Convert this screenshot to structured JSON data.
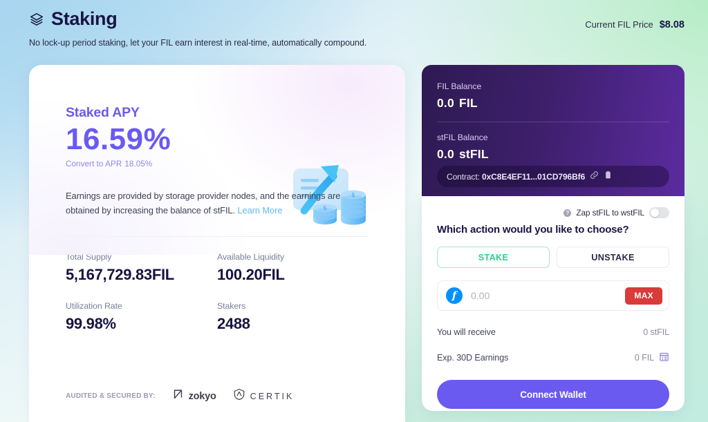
{
  "header": {
    "title": "Staking",
    "logo_icon": "layers-stack-icon",
    "subtitle": "No lock-up period staking, let your FIL earn interest in real-time, automatically compound.",
    "price_label": "Current FIL Price",
    "price_value": "$8.08"
  },
  "left_card": {
    "apy_label": "Staked APY",
    "apy_value": "16.59%",
    "convert_label": "Convert to APR",
    "convert_value": "18.05%",
    "description_text": "Earnings are provided by storage provider nodes, and the earnings are obtained by increasing the balance of stFIL.",
    "learn_more": "Learn More",
    "stats": [
      {
        "label": "Total Supply",
        "value": "5,167,729.83FIL"
      },
      {
        "label": "Available Liquidity",
        "value": "100.20FIL"
      },
      {
        "label": "Utilization Rate",
        "value": "99.98%"
      },
      {
        "label": "Stakers",
        "value": "2488"
      }
    ],
    "audit_label": "AUDITED & SECURED BY:",
    "auditors": [
      {
        "name": "zokyo",
        "icon": "zokyo-arrow-icon"
      },
      {
        "name": "CERTIK",
        "icon": "certik-shield-icon"
      }
    ]
  },
  "balance_card": {
    "fil_balance_label": "FIL Balance",
    "fil_balance_value": "0.0",
    "fil_balance_unit": "FIL",
    "stfil_balance_label": "stFIL Balance",
    "stfil_balance_value": "0.0",
    "stfil_balance_unit": "stFIL",
    "contract_prefix": "Contract:",
    "contract_address": "0xC8E4EF11...01CD796Bf6",
    "link_icon": "link-icon",
    "copy_icon": "clipboard-copy-icon"
  },
  "action_card": {
    "zap_label": "Zap stFIL to wstFIL",
    "zap_help_icon": "question-mark-icon",
    "zap_toggle_state": "off",
    "question": "Which action would you like to choose?",
    "tabs": [
      {
        "label": "STAKE",
        "active": true
      },
      {
        "label": "UNSTAKE",
        "active": false
      }
    ],
    "amount_placeholder": "0.00",
    "amount_value": "",
    "token_icon": "filecoin-icon",
    "max_label": "MAX",
    "receive_label": "You will receive",
    "receive_value": "0 stFIL",
    "earnings_label": "Exp. 30D Earnings",
    "earnings_value": "0 FIL",
    "earnings_icon": "calendar-icon",
    "connect_label": "Connect Wallet"
  },
  "colors": {
    "accent_purple": "#6a5af0",
    "accent_green": "#2fcf8e",
    "max_red": "#d93a3a",
    "dark_navy": "#181545",
    "filecoin_blue": "#0090ff"
  }
}
